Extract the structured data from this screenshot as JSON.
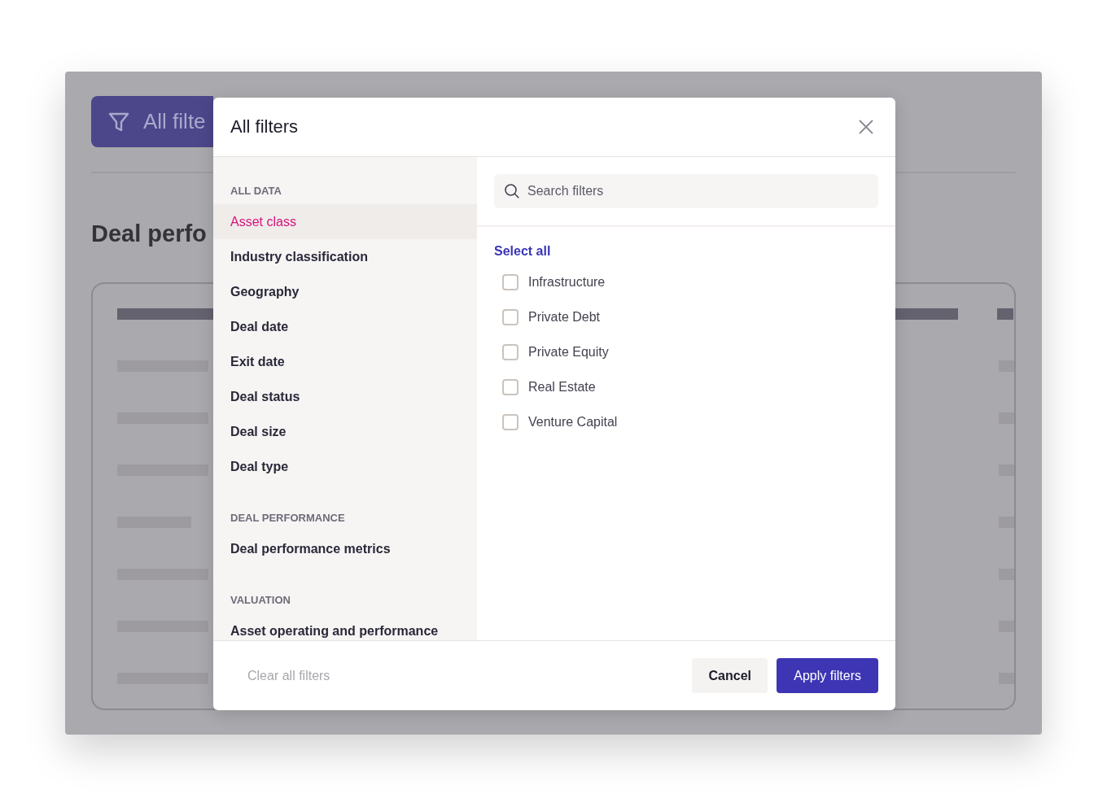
{
  "background": {
    "filter_button": {
      "label": "All filte"
    },
    "heading": "Deal perfo"
  },
  "dialog": {
    "title": "All filters",
    "sidebar": {
      "sections": [
        {
          "heading": "ALL DATA",
          "items": [
            {
              "label": "Asset class",
              "selected": true
            },
            {
              "label": "Industry classification",
              "selected": false
            },
            {
              "label": "Geography",
              "selected": false
            },
            {
              "label": "Deal date",
              "selected": false
            },
            {
              "label": "Exit date",
              "selected": false
            },
            {
              "label": "Deal status",
              "selected": false
            },
            {
              "label": "Deal size",
              "selected": false
            },
            {
              "label": "Deal type",
              "selected": false
            }
          ]
        },
        {
          "heading": "DEAL PERFORMANCE",
          "items": [
            {
              "label": "Deal performance metrics",
              "selected": false
            }
          ]
        },
        {
          "heading": "VALUATION",
          "items": [
            {
              "label": "Asset operating and performance",
              "selected": false
            }
          ]
        }
      ]
    },
    "search": {
      "placeholder": "Search filters"
    },
    "select_all": "Select all",
    "options": [
      {
        "label": "Infrastructure",
        "checked": false
      },
      {
        "label": "Private Debt",
        "checked": false
      },
      {
        "label": "Private Equity",
        "checked": false
      },
      {
        "label": "Real Estate",
        "checked": false
      },
      {
        "label": "Venture Capital",
        "checked": false
      }
    ],
    "footer": {
      "clear": {
        "label": "Clear all filters",
        "disabled": true
      },
      "cancel": "Cancel",
      "apply": "Apply filters"
    }
  }
}
